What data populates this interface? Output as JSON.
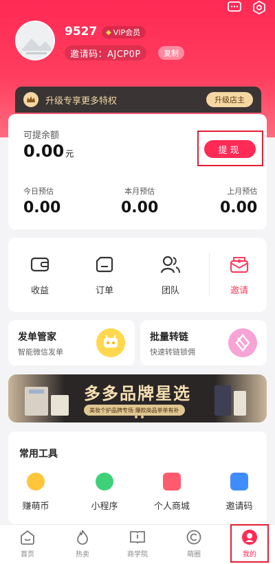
{
  "profile": {
    "username": "9527",
    "vip_label": "VIP会员",
    "invite_label": "邀请码：AJCP0P",
    "copy_label": "复制"
  },
  "upgrade": {
    "text": "升级专享更多特权",
    "button": "升级店主"
  },
  "balance": {
    "label": "可提余额",
    "value": "0.00",
    "unit": "元",
    "withdraw": "提现",
    "estimates": [
      {
        "label": "今日预估",
        "value": "0.00"
      },
      {
        "label": "本月预估",
        "value": "0.00"
      },
      {
        "label": "上月预估",
        "value": "0.00"
      }
    ]
  },
  "menu": {
    "items": [
      {
        "label": "收益",
        "icon": "wallet-icon"
      },
      {
        "label": "订单",
        "icon": "order-icon"
      },
      {
        "label": "团队",
        "icon": "team-icon"
      },
      {
        "label": "邀请",
        "icon": "invite-icon"
      }
    ]
  },
  "promos": [
    {
      "title": "发单管家",
      "sub": "智能微信发单",
      "color": "#ffd84d"
    },
    {
      "title": "批量转链",
      "sub": "快速转链锁佣",
      "color": "#f7a3d5"
    }
  ],
  "banner": {
    "title": "多多品牌星选",
    "sub": "美妆个护品牌专场 爆款商品单单有补"
  },
  "tools": {
    "title": "常用工具",
    "items": [
      {
        "label": "赚萌币",
        "color": "#ffc63a"
      },
      {
        "label": "小程序",
        "color": "#3fd17a"
      },
      {
        "label": "个人商城",
        "color": "#ff5a6e"
      },
      {
        "label": "邀请码",
        "color": "#3f8cff"
      }
    ]
  },
  "tabs": [
    {
      "label": "首页",
      "icon": "home-icon"
    },
    {
      "label": "热卖",
      "icon": "fire-icon"
    },
    {
      "label": "商学院",
      "icon": "book-icon"
    },
    {
      "label": "萌圈",
      "icon": "circle-icon"
    },
    {
      "label": "我的",
      "icon": "mine-icon"
    }
  ],
  "colors": {
    "accent": "#ff2a55",
    "highlight": "#e51c32"
  }
}
